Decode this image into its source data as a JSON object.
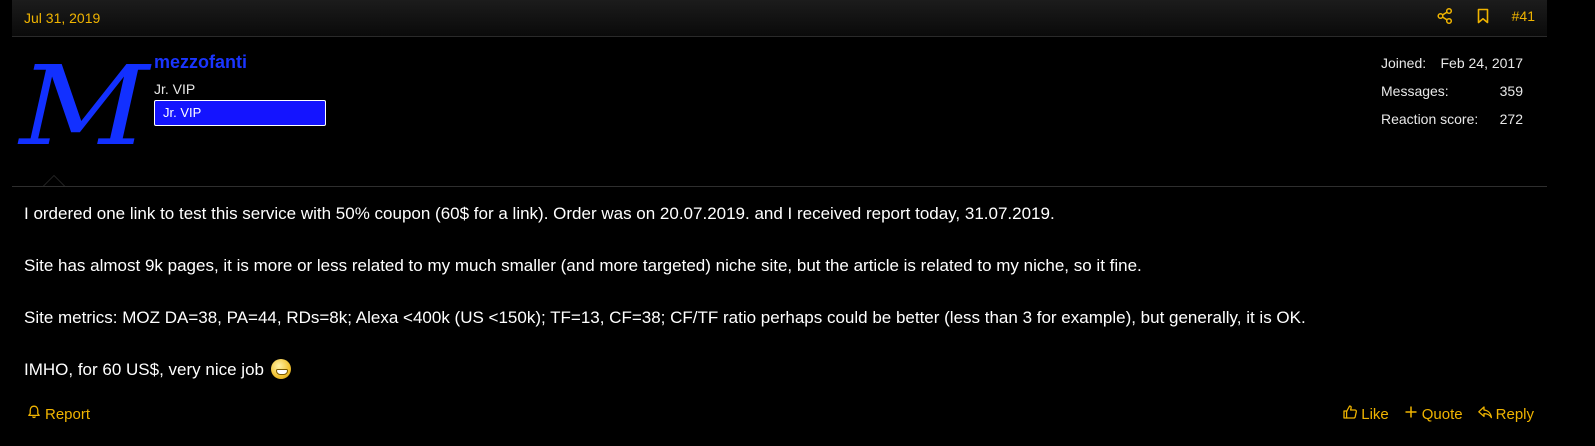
{
  "post": {
    "date": "Jul 31, 2019",
    "number": "#41",
    "icons": {
      "share": "share-icon",
      "bookmark": "bookmark-icon"
    }
  },
  "user": {
    "avatar_letter": "M",
    "name": "mezzofanti",
    "title": "Jr. VIP",
    "badge": "Jr. VIP"
  },
  "stats": [
    {
      "label": "Joined:",
      "value": "Feb 24, 2017"
    },
    {
      "label": "Messages:",
      "value": "359"
    },
    {
      "label": "Reaction score:",
      "value": "272"
    }
  ],
  "body": {
    "paragraphs": [
      "I ordered one link to test this service with 50% coupon (60$ for a link). Order was on 20.07.2019. and I received report today, 31.07.2019.",
      "Site has almost 9k pages, it is more or less related to my much smaller (and more targeted) niche site, but the article is related to my niche, so it fine.",
      "Site metrics: MOZ DA=38, PA=44, RDs=8k; Alexa <400k (US <150k); TF=13, CF=38; CF/TF ratio perhaps could be better (less than 3 for example), but generally, it is OK.",
      "IMHO, for 60 US$, very nice job"
    ],
    "emoji": "grin-smiley"
  },
  "footer": {
    "report": "Report",
    "like": "Like",
    "quote": "Quote",
    "reply": "Reply"
  },
  "colors": {
    "accent": "#f0b400",
    "username": "#1a35ff",
    "badge_bg": "#1414ff",
    "background": "#000000"
  }
}
